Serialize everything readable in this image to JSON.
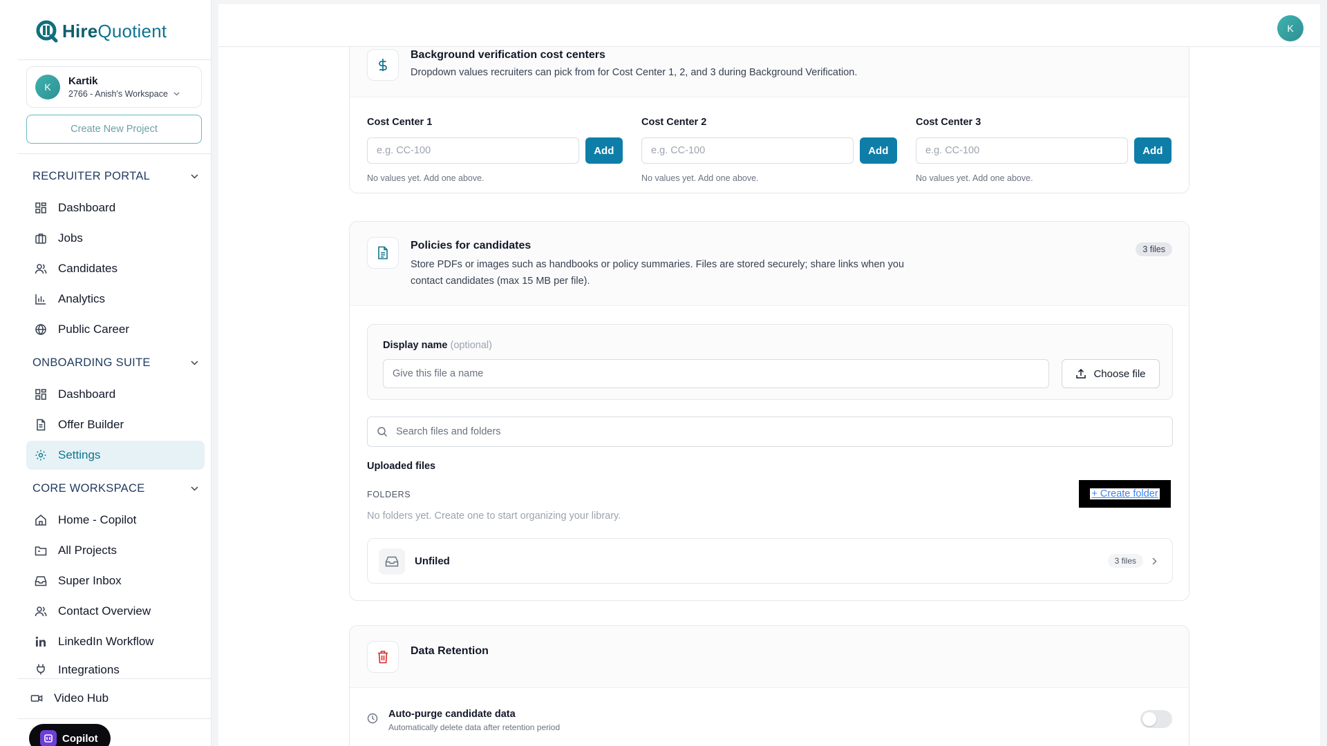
{
  "brand": {
    "name_bold": "Hire",
    "name_light": "Quotient",
    "accent": "#0e7490"
  },
  "workspace": {
    "avatar_initial": "K",
    "user_name": "Kartik",
    "workspace_label": "2766 - Anish's Workspace"
  },
  "sidebar": {
    "create_project_label": "Create New Project",
    "sections": [
      {
        "title": "RECRUITER PORTAL",
        "items": [
          {
            "label": "Dashboard",
            "icon": "grid-icon"
          },
          {
            "label": "Jobs",
            "icon": "briefcase-icon"
          },
          {
            "label": "Candidates",
            "icon": "users-icon"
          },
          {
            "label": "Analytics",
            "icon": "bar-chart-icon"
          },
          {
            "label": "Public Career",
            "icon": "globe-icon"
          }
        ]
      },
      {
        "title": "ONBOARDING SUITE",
        "items": [
          {
            "label": "Dashboard",
            "icon": "grid-icon"
          },
          {
            "label": "Offer Builder",
            "icon": "document-icon"
          },
          {
            "label": "Settings",
            "icon": "gear-icon",
            "active": true
          }
        ]
      },
      {
        "title": "CORE WORKSPACE",
        "items": [
          {
            "label": "Home - Copilot",
            "icon": "home-icon"
          },
          {
            "label": "All Projects",
            "icon": "folder-icon"
          },
          {
            "label": "Super Inbox",
            "icon": "inbox-icon"
          },
          {
            "label": "Contact Overview",
            "icon": "users-icon"
          },
          {
            "label": "LinkedIn Workflow",
            "icon": "linkedin-icon"
          },
          {
            "label": "Integrations",
            "icon": "plug-icon"
          }
        ]
      }
    ],
    "video_hub_label": "Video Hub",
    "copilot_label": "Copilot"
  },
  "topbar": {
    "avatar_initial": "K"
  },
  "cost_centers": {
    "title": "Background verification cost centers",
    "description": "Dropdown values recruiters can pick from for Cost Center 1, 2, and 3 during Background Verification.",
    "columns": [
      {
        "label": "Cost Center 1",
        "placeholder": "e.g. CC-100",
        "button": "Add",
        "note": "No values yet. Add one above."
      },
      {
        "label": "Cost Center 2",
        "placeholder": "e.g. CC-100",
        "button": "Add",
        "note": "No values yet. Add one above."
      },
      {
        "label": "Cost Center 3",
        "placeholder": "e.g. CC-100",
        "button": "Add",
        "note": "No values yet. Add one above."
      }
    ]
  },
  "policies": {
    "title": "Policies for candidates",
    "description_line1": "Store PDFs or images such as handbooks or policy summaries. Files are stored securely; share links when you",
    "description_line2": "contact candidates (max 15 MB per file).",
    "file_count_badge": "3 files",
    "display_name_label": "Display name",
    "display_name_optional": "(optional)",
    "display_name_placeholder": "Give this file a name",
    "choose_file_label": "Choose file",
    "search_placeholder": "Search files and folders",
    "uploaded_files_title": "Uploaded files",
    "folders_label": "FOLDERS",
    "create_folder_label": "+ Create folder",
    "no_folders_text": "No folders yet. Create one to start organizing your library.",
    "unfiled": {
      "label": "Unfiled",
      "count": "3 files"
    }
  },
  "data_retention": {
    "title": "Data Retention",
    "auto_purge_title": "Auto-purge candidate data",
    "auto_purge_desc": "Automatically delete data after retention period",
    "auto_purge_enabled": false
  }
}
